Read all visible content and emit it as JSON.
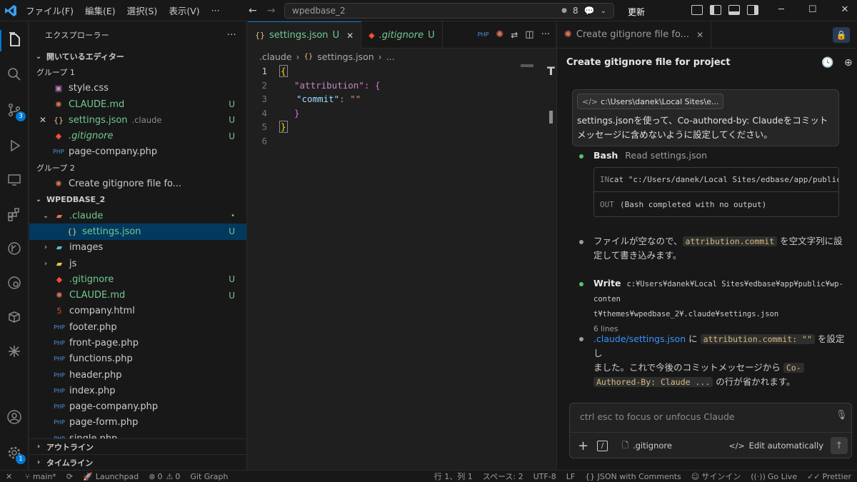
{
  "titlebar": {
    "menus": [
      "ファイル(F)",
      "編集(E)",
      "選択(S)",
      "表示(V)",
      "···"
    ],
    "search_text": "wpedbase_2",
    "counter": "8",
    "update_label": "更新"
  },
  "activitybar": {
    "source_control_badge": "3",
    "settings_badge": "1"
  },
  "sidebar": {
    "title": "エクスプローラー",
    "open_editors_label": "開いているエディター",
    "group1_label": "グループ 1",
    "group1_items": [
      {
        "name": "style.css",
        "badge": ""
      },
      {
        "name": "CLAUDE.md",
        "badge": "U"
      },
      {
        "name": "settings.json",
        "hint": ".claude",
        "badge": "U"
      },
      {
        "name": ".gitignore",
        "badge": "U"
      },
      {
        "name": "page-company.php",
        "badge": ""
      }
    ],
    "group2_label": "グループ 2",
    "group2_items": [
      {
        "name": "Create gitignore file fo..."
      }
    ],
    "project_label": "WPEDBASE_2",
    "tree": [
      {
        "name": ".claude",
        "badge": "•"
      },
      {
        "name": "settings.json",
        "badge": "U"
      },
      {
        "name": "images",
        "badge": ""
      },
      {
        "name": "js",
        "badge": ""
      },
      {
        "name": ".gitignore",
        "badge": "U"
      },
      {
        "name": "CLAUDE.md",
        "badge": "U"
      },
      {
        "name": "company.html",
        "badge": ""
      },
      {
        "name": "footer.php",
        "badge": ""
      },
      {
        "name": "front-page.php",
        "badge": ""
      },
      {
        "name": "functions.php",
        "badge": ""
      },
      {
        "name": "header.php",
        "badge": ""
      },
      {
        "name": "index.php",
        "badge": ""
      },
      {
        "name": "page-company.php",
        "badge": ""
      },
      {
        "name": "page-form.php",
        "badge": ""
      },
      {
        "name": "single.php",
        "badge": ""
      }
    ],
    "outline_label": "アウトライン",
    "timeline_label": "タイムライン"
  },
  "editor": {
    "tabs": [
      {
        "label": "settings.json",
        "badge": "U"
      },
      {
        "label": ".gitignore",
        "badge": "U"
      }
    ],
    "breadcrumb": [
      ".claude",
      "settings.json",
      "..."
    ],
    "code_lines": [
      {
        "num": "1",
        "text": "{"
      },
      {
        "num": "2",
        "key": "\"attribution\"",
        "rest": ": {"
      },
      {
        "num": "3",
        "key": "\"commit\"",
        "rest": ": \"\""
      },
      {
        "num": "4",
        "text": "}"
      },
      {
        "num": "5",
        "text": "}"
      },
      {
        "num": "6",
        "text": ""
      }
    ]
  },
  "chat": {
    "tab_label": "Create gitignore file fo...",
    "title": "Create gitignore file for project",
    "user_path_chip": "c:\\Users\\danek\\Local Sites\\e...",
    "user_message": "settings.jsonを使って、Co-authored-by: Claudeをコミットメッセージに含めないように設定してください。",
    "bash_tool": "Bash",
    "bash_desc": "Read settings.json",
    "bash_in_label": "IN",
    "bash_in": "cat \"c:/Users/danek/Local Sites/edbase/app/public/wp-",
    "bash_out_label": "OUT",
    "bash_out": "(Bash completed with no output)",
    "msg1_pre": "ファイルが空なので、",
    "msg1_code": "attribution.commit",
    "msg1_post": " を空文字列に設",
    "msg1_line2": "定して書き込みます。",
    "write_tool": "Write",
    "write_path_1": "c:¥Users¥danek¥Local Sites¥edbase¥app¥public¥wp-conten",
    "write_path_2": "t¥themes¥wpedbase_2¥.claude¥settings.json",
    "write_lines": "6 lines",
    "final_link": ".claude/settings.json",
    "final_pre": " に ",
    "final_code1": "attribution.commit: \"\"",
    "final_mid": " を設定し",
    "final_line2": "ました。これで今後のコミットメッセージから ",
    "final_code2a": "Co-",
    "final_code2b": "Authored-By: Claude ...",
    "final_end": " の行が省かれます。",
    "input_placeholder": "ctrl esc to focus or unfocus Claude",
    "attached_file": ".gitignore",
    "edit_mode": "Edit automatically"
  },
  "statusbar": {
    "branch": "main*",
    "launchpad": "Launchpad",
    "errors": "0",
    "warnings": "0",
    "gitgraph": "Git Graph",
    "position": "行 1、列 1",
    "spaces": "スペース: 2",
    "encoding": "UTF-8",
    "eol": "LF",
    "language": "{} JSON with Comments",
    "signin": "サインイン",
    "golive": "Go Live",
    "prettier": "Prettier"
  },
  "colors": {
    "accent": "#0078d4",
    "untracked": "#73c991",
    "claude_orange": "#d97757",
    "json_key": "#9cdcfe"
  }
}
